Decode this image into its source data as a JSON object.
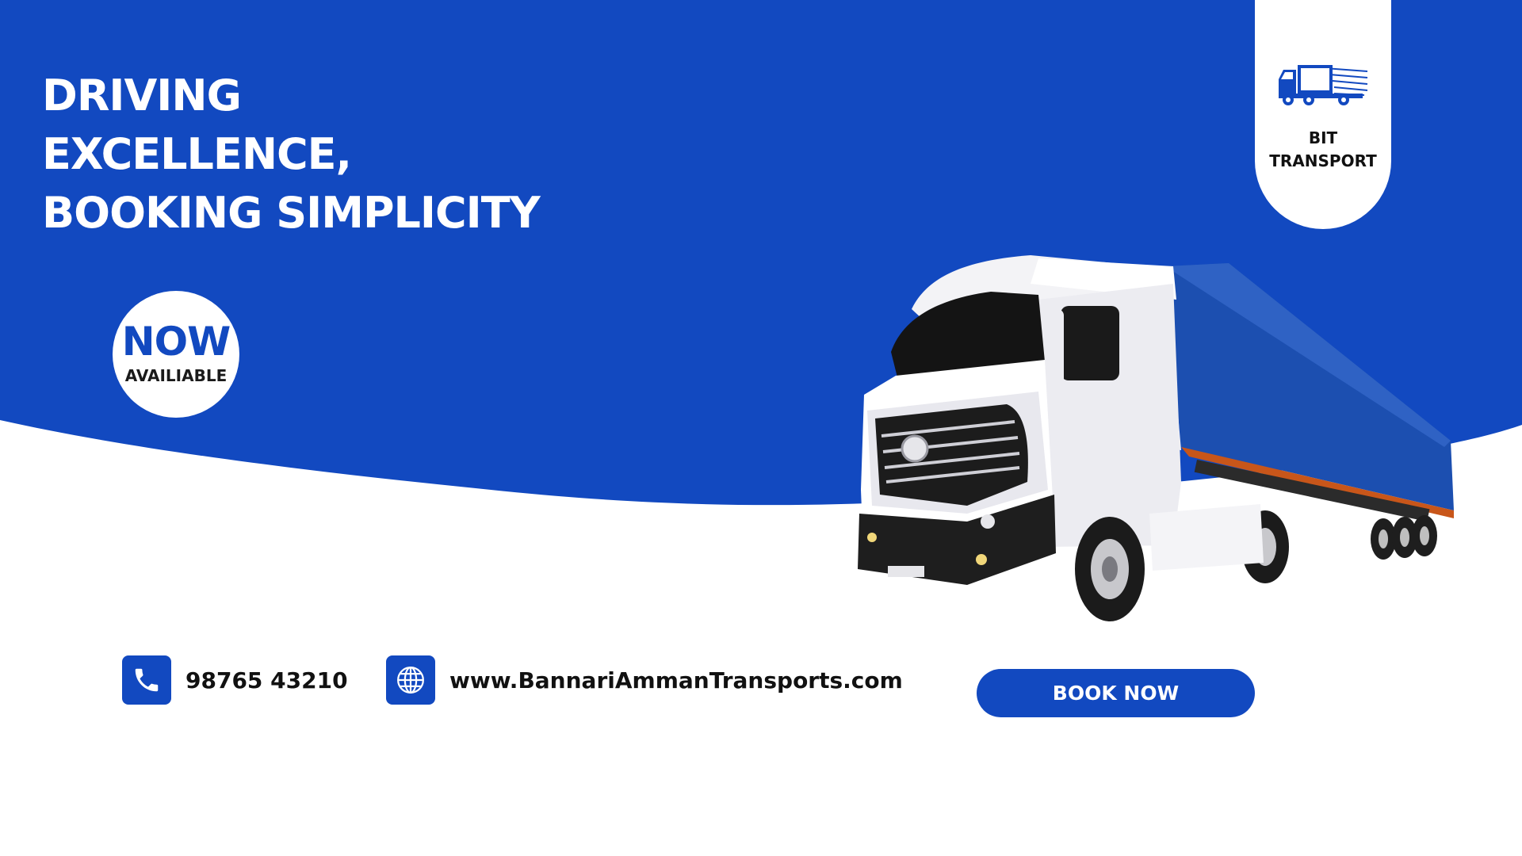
{
  "brand": {
    "name_line1": "BIT",
    "name_line2": "TRANSPORT"
  },
  "headline": {
    "line1": "DRIVING",
    "line2": "EXCELLENCE,",
    "line3": "BOOKING SIMPLICITY"
  },
  "badge": {
    "main": "NOW",
    "sub": "AVAILIABLE"
  },
  "contact": {
    "phone": "98765 43210",
    "website": "www.BannariAmmanTransports.com"
  },
  "cta": {
    "label": "BOOK NOW"
  },
  "icons": {
    "phone": "phone-icon",
    "website": "globe-icon",
    "logo": "truck-logo-icon"
  },
  "colors": {
    "brand_blue": "#1249c0",
    "background": "#ffffff",
    "text_dark": "#111111"
  }
}
